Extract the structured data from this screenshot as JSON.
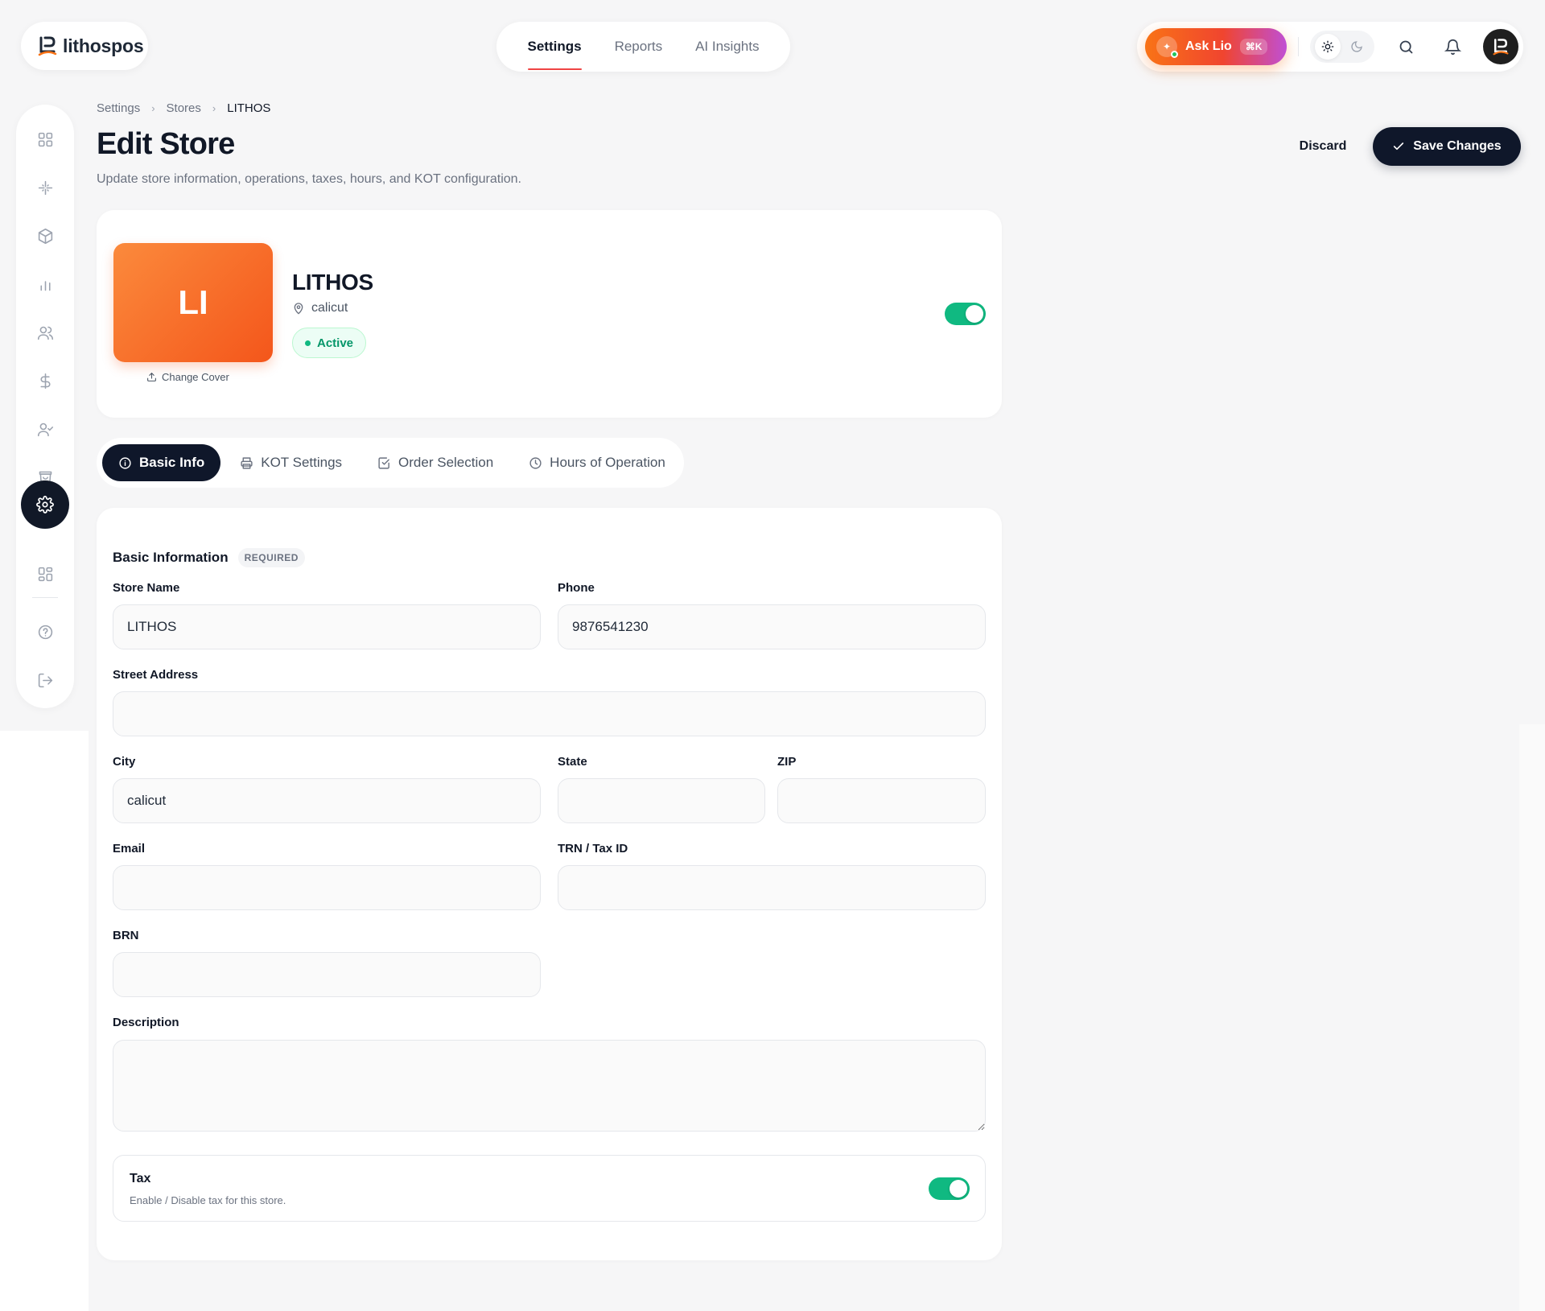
{
  "app": {
    "name": "lithospos"
  },
  "topnav": {
    "items": [
      "Settings",
      "Reports",
      "AI Insights"
    ],
    "active": "Settings"
  },
  "header": {
    "ask_label": "Ask Lio",
    "ask_shortcut": "⌘K"
  },
  "breadcrumb": {
    "items": [
      "Settings",
      "Stores",
      "LITHOS"
    ]
  },
  "page": {
    "title": "Edit Store",
    "subtitle": "Update store information, operations, taxes, hours, and KOT configuration.",
    "discard_label": "Discard",
    "save_label": "Save Changes"
  },
  "store": {
    "initials": "LI",
    "name": "LITHOS",
    "location": "calicut",
    "status": "Active",
    "change_cover_label": "Change Cover",
    "enabled": true
  },
  "tabs": [
    {
      "label": "Basic Info",
      "icon": "info-icon"
    },
    {
      "label": "KOT Settings",
      "icon": "printer-icon"
    },
    {
      "label": "Order Selection",
      "icon": "checkbox-icon"
    },
    {
      "label": "Hours of Operation",
      "icon": "clock-icon"
    }
  ],
  "form": {
    "section_title": "Basic Information",
    "section_badge": "REQUIRED",
    "fields": {
      "store_name": {
        "label": "Store Name",
        "value": "LITHOS"
      },
      "phone": {
        "label": "Phone",
        "value": "9876541230"
      },
      "street_address": {
        "label": "Street Address",
        "value": ""
      },
      "city": {
        "label": "City",
        "value": "calicut"
      },
      "state": {
        "label": "State",
        "value": ""
      },
      "zip": {
        "label": "ZIP",
        "value": ""
      },
      "email": {
        "label": "Email",
        "value": ""
      },
      "trn": {
        "label": "TRN / Tax ID",
        "value": ""
      },
      "brn": {
        "label": "BRN",
        "value": ""
      },
      "description": {
        "label": "Description",
        "value": ""
      }
    },
    "tax": {
      "title": "Tax",
      "description": "Enable / Disable tax for this store.",
      "enabled": true
    }
  },
  "colors": {
    "accent": "#f4561b",
    "primary_dark": "#0f172a",
    "success": "#10b981"
  }
}
